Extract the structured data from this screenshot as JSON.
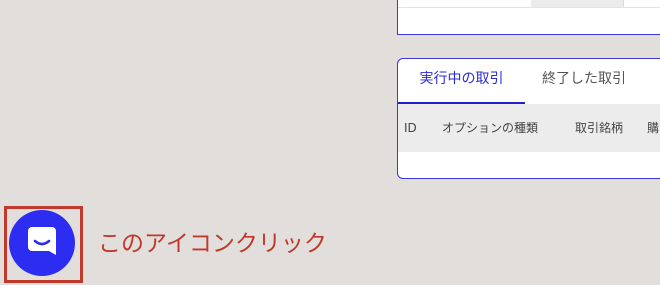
{
  "trades": {
    "tabs": {
      "active": "実行中の取引",
      "inactive": "終了した取引"
    },
    "columns": {
      "id": "ID",
      "option_type": "オプションの種類",
      "pair": "取引銘柄",
      "buy": "購"
    }
  },
  "annotation": {
    "text": "このアイコンクリック"
  },
  "colors": {
    "accent": "#2d2df2",
    "highlight": "#c0392b",
    "background": "#e1dedb"
  },
  "icons": {
    "chat": "chat-bubble-icon"
  }
}
